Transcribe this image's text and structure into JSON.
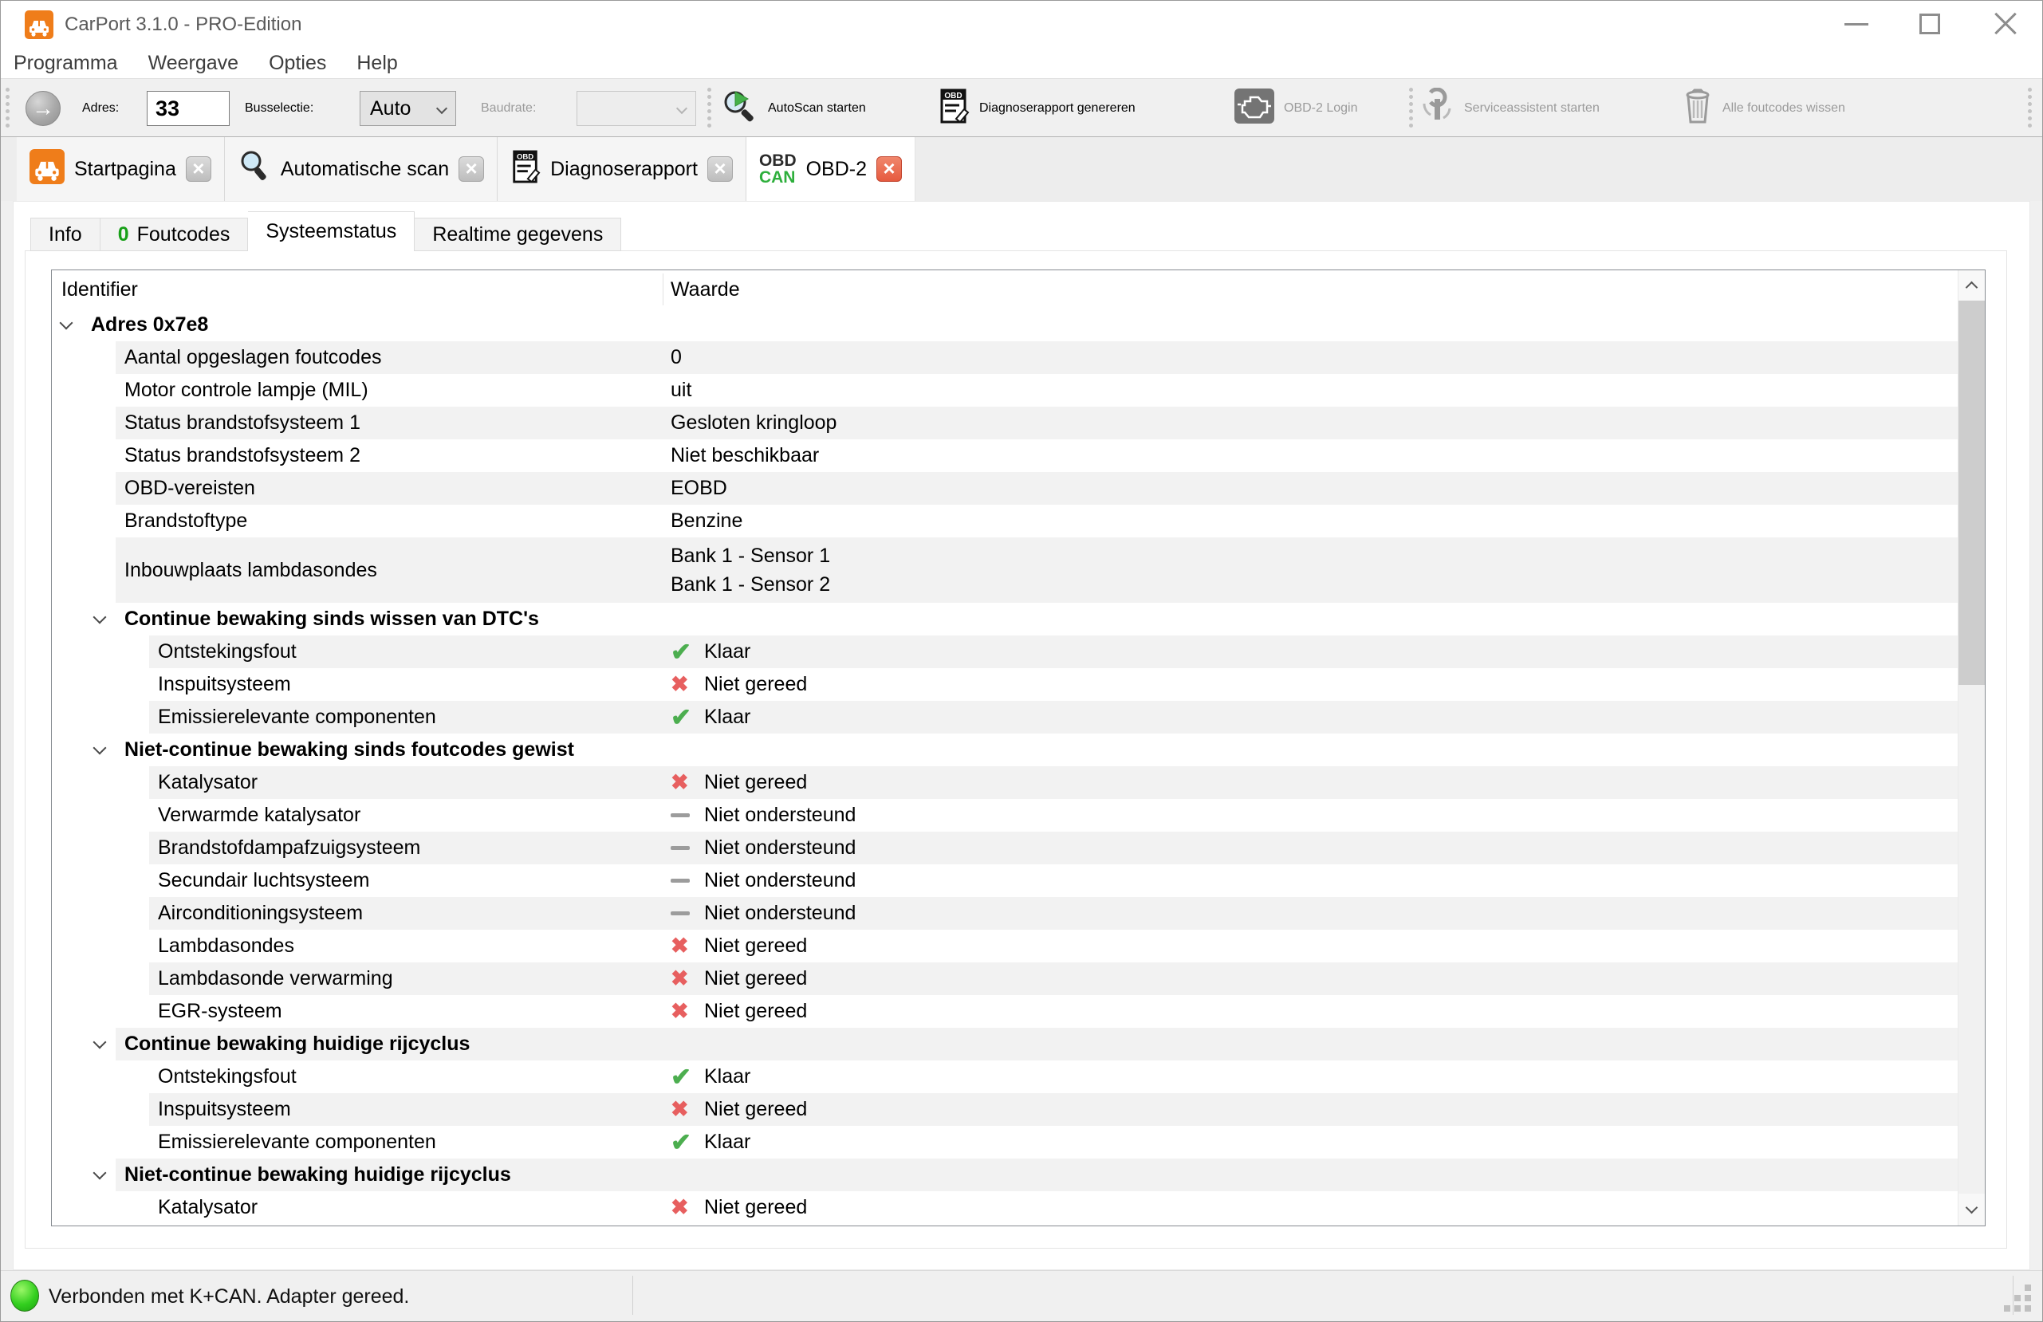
{
  "window": {
    "title": "CarPort 3.1.0 - PRO-Edition"
  },
  "menu": {
    "items": [
      "Programma",
      "Weergave",
      "Opties",
      "Help"
    ]
  },
  "toolbar": {
    "adres_label": "Adres:",
    "adres_value": "33",
    "bus_label": "Busselectie:",
    "bus_value": "Auto",
    "baud_label": "Baudrate:",
    "baud_value": "",
    "autoscan_label": "AutoScan starten",
    "report_label": "Diagnoserapport genereren",
    "login_label": "OBD-2 Login",
    "service_label": "Serviceassistent starten",
    "clear_label": "Alle foutcodes wissen"
  },
  "tabs": [
    {
      "label": "Startpagina",
      "icon": "car-icon",
      "active": false
    },
    {
      "label": "Automatische scan",
      "icon": "magnifier-icon",
      "active": false
    },
    {
      "label": "Diagnoserapport",
      "icon": "obd-document-icon",
      "active": false
    },
    {
      "label": "OBD-2",
      "icon": "obd-can-icon",
      "icon_text_top": "OBD",
      "icon_text_bottom": "CAN",
      "active": true
    }
  ],
  "subtabs": [
    {
      "label": "Info",
      "active": false
    },
    {
      "label": "Foutcodes",
      "badge": "0",
      "active": false
    },
    {
      "label": "Systeemstatus",
      "active": true
    },
    {
      "label": "Realtime gegevens",
      "active": false
    }
  ],
  "table": {
    "columns": [
      "Identifier",
      "Waarde"
    ],
    "rows": [
      {
        "label": "Adres 0x7e8",
        "group": true,
        "level": 0,
        "value": ""
      },
      {
        "label": "Aantal opgeslagen foutcodes",
        "group": false,
        "level": 1,
        "value": "0"
      },
      {
        "label": "Motor controle lampje (MIL)",
        "group": false,
        "level": 1,
        "value": "uit"
      },
      {
        "label": "Status brandstofsysteem 1",
        "group": false,
        "level": 1,
        "value": "Gesloten kringloop"
      },
      {
        "label": "Status brandstofsysteem 2",
        "group": false,
        "level": 1,
        "value": "Niet beschikbaar"
      },
      {
        "label": "OBD-vereisten",
        "group": false,
        "level": 1,
        "value": "EOBD"
      },
      {
        "label": "Brandstoftype",
        "group": false,
        "level": 1,
        "value": "Benzine"
      },
      {
        "label": "Inbouwplaats lambdasondes",
        "group": false,
        "level": 1,
        "values": [
          "Bank 1 - Sensor 1",
          "Bank 1 - Sensor 2"
        ]
      },
      {
        "label": "Continue bewaking sinds wissen van DTC's",
        "group": true,
        "level": 1,
        "value": ""
      },
      {
        "label": "Ontstekingsfout",
        "group": false,
        "level": 2,
        "icon": "check-icon",
        "value": "Klaar"
      },
      {
        "label": "Inspuitsysteem",
        "group": false,
        "level": 2,
        "icon": "cross-icon",
        "value": "Niet gereed"
      },
      {
        "label": "Emissierelevante componenten",
        "group": false,
        "level": 2,
        "icon": "check-icon",
        "value": "Klaar"
      },
      {
        "label": "Niet-continue bewaking sinds foutcodes gewist",
        "group": true,
        "level": 1,
        "value": ""
      },
      {
        "label": "Katalysator",
        "group": false,
        "level": 2,
        "icon": "cross-icon",
        "value": "Niet gereed"
      },
      {
        "label": "Verwarmde katalysator",
        "group": false,
        "level": 2,
        "icon": "dash-icon",
        "value": "Niet ondersteund"
      },
      {
        "label": "Brandstofdampafzuigsysteem",
        "group": false,
        "level": 2,
        "icon": "dash-icon",
        "value": "Niet ondersteund"
      },
      {
        "label": "Secundair luchtsysteem",
        "group": false,
        "level": 2,
        "icon": "dash-icon",
        "value": "Niet ondersteund"
      },
      {
        "label": "Airconditioningsysteem",
        "group": false,
        "level": 2,
        "icon": "dash-icon",
        "value": "Niet ondersteund"
      },
      {
        "label": "Lambdasondes",
        "group": false,
        "level": 2,
        "icon": "cross-icon",
        "value": "Niet gereed"
      },
      {
        "label": "Lambdasonde verwarming",
        "group": false,
        "level": 2,
        "icon": "cross-icon",
        "value": "Niet gereed"
      },
      {
        "label": "EGR-systeem",
        "group": false,
        "level": 2,
        "icon": "cross-icon",
        "value": "Niet gereed"
      },
      {
        "label": "Continue bewaking huidige rijcyclus",
        "group": true,
        "level": 1,
        "value": ""
      },
      {
        "label": "Ontstekingsfout",
        "group": false,
        "level": 2,
        "icon": "check-icon",
        "value": "Klaar"
      },
      {
        "label": "Inspuitsysteem",
        "group": false,
        "level": 2,
        "icon": "cross-icon",
        "value": "Niet gereed"
      },
      {
        "label": "Emissierelevante componenten",
        "group": false,
        "level": 2,
        "icon": "check-icon",
        "value": "Klaar"
      },
      {
        "label": "Niet-continue bewaking huidige rijcyclus",
        "group": true,
        "level": 1,
        "value": ""
      },
      {
        "label": "Katalysator",
        "group": false,
        "level": 2,
        "icon": "cross-icon",
        "value": "Niet gereed"
      }
    ]
  },
  "statusbar": {
    "text": "Verbonden met K+CAN. Adapter gereed."
  },
  "colors": {
    "brand_orange": "#ef7d1a",
    "check_green": "#4cae4f",
    "cross_red": "#e75f5f",
    "dash_gray": "#9c9c9c",
    "badge_green": "#18a018",
    "can_green": "#2eaf3c",
    "tab_close_red": "#e65a3f",
    "led_green": "#33cf1f"
  }
}
